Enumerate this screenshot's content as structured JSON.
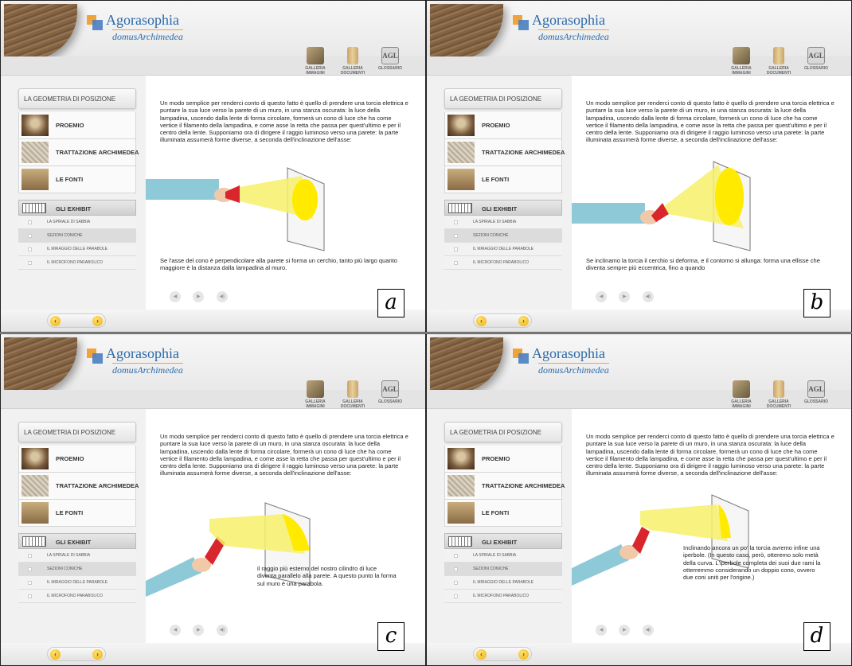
{
  "app": {
    "brand": "Agorasophia",
    "subbrand": "domusArchimedea"
  },
  "toolbar": {
    "gallery_images": "GALLERIA\nIMMAGINI",
    "gallery_docs": "GALLERIA\nDOCUMENTI",
    "glossary": "GLOSSARIO",
    "glossary_icon_text": "AGL"
  },
  "sidebar": {
    "section_title": "LA GEOMETRIA DI POSIZIONE",
    "items": [
      {
        "label": "PROEMIO"
      },
      {
        "label": "TRATTAZIONE ARCHIMEDEA"
      },
      {
        "label": "LE FONTI"
      }
    ],
    "exhibit_title": "GLI EXHIBIT",
    "exhibits": [
      {
        "label": "LA SPIRALE DI SABBIA"
      },
      {
        "label": "SEZIONI CONICHE"
      },
      {
        "label": "IL MIRAGGIO DELLE PARABOLE"
      },
      {
        "label": "IL MICROFONO PARABOLICO"
      }
    ],
    "active_exhibit": "SEZIONI CONICHE"
  },
  "intro_text": "Un modo semplice per renderci conto di questo fatto è quello di prendere una torcia elettrica e puntare la sua luce verso la parete di un muro, in una stanza oscurata: la luce della lampadina, uscendo dalla lente di forma circolare, formerà un cono di luce che ha come vertice il filamento della lampadina, e come asse la retta che passa per quest'ultimo e per il centro della lente. Supponiamo ora di dirigere il raggio luminoso verso una parete: la parte illuminata assumerà forme diverse, a seconda dell'inclinazione dell'asse:",
  "panels": [
    {
      "letter": "a",
      "caption": "Se l'asse del cono è perpendicolare alla parete si forma un cerchio, tanto più largo quanto maggiore è la distanza dalla lampadina al muro."
    },
    {
      "letter": "b",
      "caption": "Se inclinamo la torcia il cerchio si deforma, e il contorno si allunga: forma una ellisse che diventa sempre più eccentrica, fino a quando"
    },
    {
      "letter": "c",
      "caption": "il raggio più esterno del nostro cilindro di luce diventa parallelo alla parete. A questo punto la forma  sul muro è una parabola."
    },
    {
      "letter": "d",
      "caption": "Inclinando ancora un po' la torcia avremo infine una iperbole. (In questo caso, però, otteremo solo metà della curva. L'iperbole completa dei suoi due rami la otterremmo considerando un doppio cono, ovvero due coni uniti per l'origine.)"
    }
  ],
  "controls": {
    "back": "◀",
    "play": "▶",
    "audio": "◀)"
  },
  "pager": {
    "prev": "‹",
    "next": "›"
  },
  "colors": {
    "brand_blue": "#2b6aa8",
    "brand_orange": "#f2a23a",
    "light_beam": "#f7f06a",
    "light_spot": "#ffea00",
    "sleeve": "#8ec9d8",
    "torch": "#d8262c"
  }
}
